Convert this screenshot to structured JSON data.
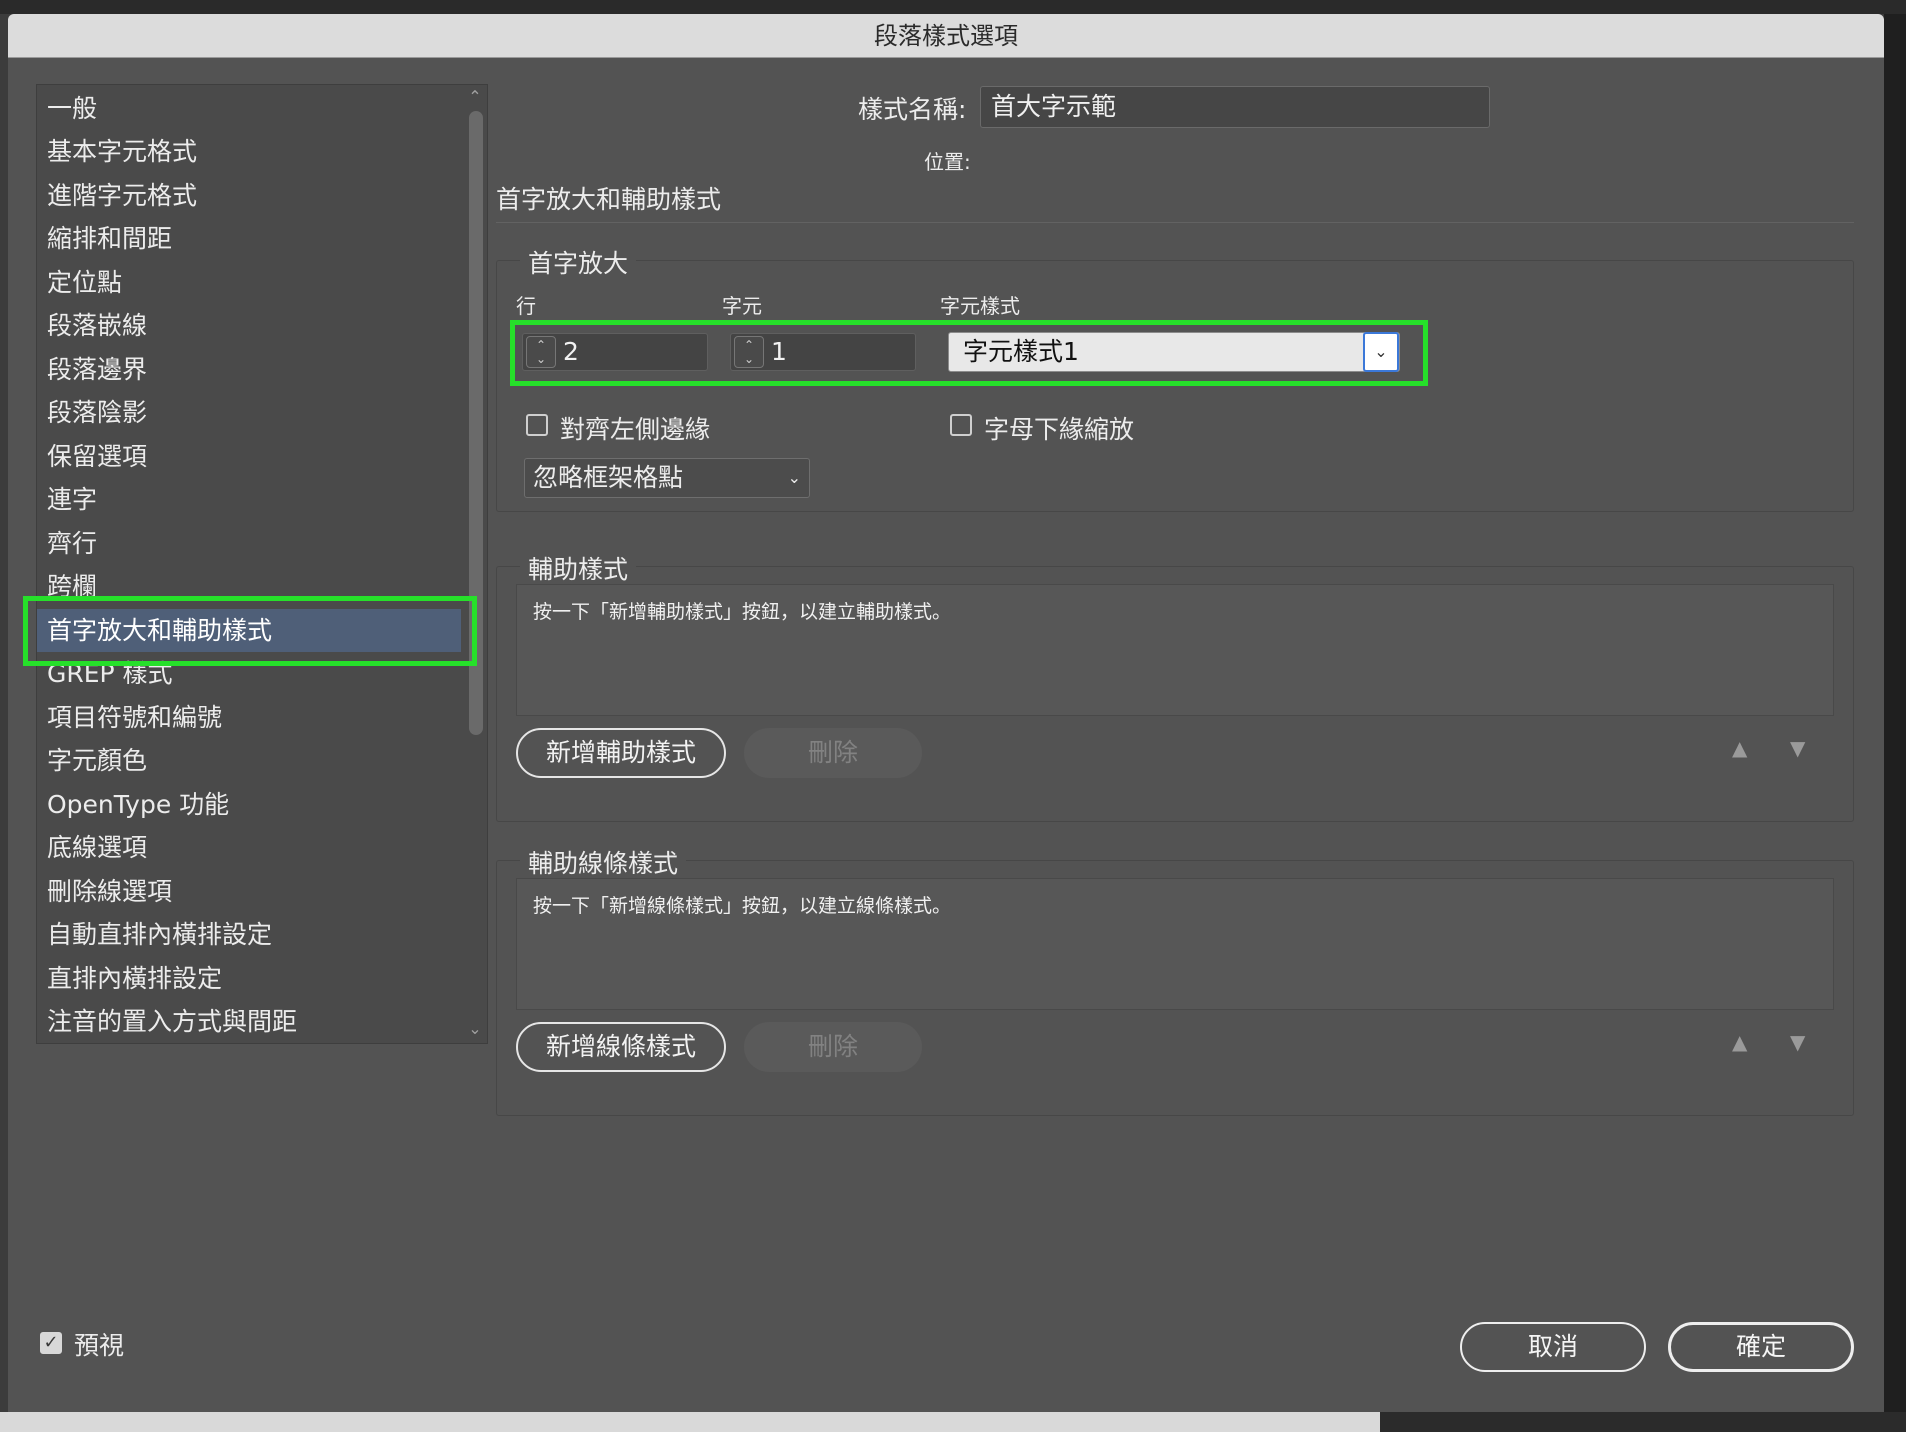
{
  "window": {
    "title": "段落樣式選項"
  },
  "sidebar": {
    "items": [
      {
        "label": "一般"
      },
      {
        "label": "基本字元格式"
      },
      {
        "label": "進階字元格式"
      },
      {
        "label": "縮排和間距"
      },
      {
        "label": "定位點"
      },
      {
        "label": "段落嵌線"
      },
      {
        "label": "段落邊界"
      },
      {
        "label": "段落陰影"
      },
      {
        "label": "保留選項"
      },
      {
        "label": "連字"
      },
      {
        "label": "齊行"
      },
      {
        "label": "跨欄"
      },
      {
        "label": "首字放大和輔助樣式",
        "selected": true
      },
      {
        "label": "GREP 樣式"
      },
      {
        "label": "項目符號和編號"
      },
      {
        "label": "字元顏色"
      },
      {
        "label": "OpenType 功能"
      },
      {
        "label": "底線選項"
      },
      {
        "label": "刪除線選項"
      },
      {
        "label": "自動直排內橫排設定"
      },
      {
        "label": "直排內橫排設定"
      },
      {
        "label": "注音的置入方式與間距"
      }
    ]
  },
  "header": {
    "style_name_label": "樣式名稱:",
    "style_name_value": "首大字示範",
    "location_label": "位置:",
    "section_title": "首字放大和輔助樣式"
  },
  "drop_caps": {
    "group_title": "首字放大",
    "lines_label": "行",
    "lines_value": "2",
    "chars_label": "字元",
    "chars_value": "1",
    "char_style_label": "字元樣式",
    "char_style_value": "字元樣式1",
    "align_left_edge_label": "對齊左側邊緣",
    "align_left_edge_checked": false,
    "scale_descenders_label": "字母下緣縮放",
    "scale_descenders_checked": false,
    "frame_grid_value": "忽略框架格點"
  },
  "nested_styles": {
    "group_title": "輔助樣式",
    "hint": "按一下「新增輔助樣式」按鈕，以建立輔助樣式。",
    "new_button": "新增輔助樣式",
    "delete_button": "刪除"
  },
  "nested_line_styles": {
    "group_title": "輔助線條樣式",
    "hint": "按一下「新增線條樣式」按鈕，以建立線條樣式。",
    "new_button": "新增線條樣式",
    "delete_button": "刪除"
  },
  "footer": {
    "preview_label": "預視",
    "preview_checked": true,
    "cancel_button": "取消",
    "ok_button": "確定"
  },
  "colors": {
    "highlight": "#26e02a",
    "selection": "#4f5f78",
    "dialog_bg": "#535353"
  }
}
